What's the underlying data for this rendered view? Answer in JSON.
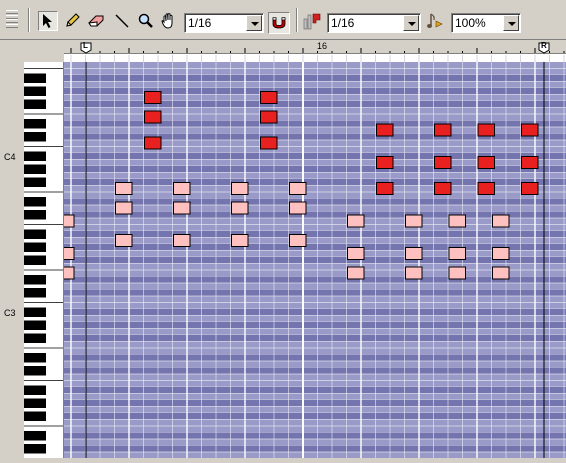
{
  "toolbar": {
    "snap_value": "1/16",
    "quantize_value": "1/16",
    "zoom_value": "100%"
  },
  "ruler": {
    "bar_label": "16",
    "left_marker": "L",
    "right_marker": "R"
  },
  "piano": {
    "c4_label": "C4",
    "c3_label": "C3"
  },
  "colors": {
    "grid_row_light": "#9a9ac8",
    "grid_row_dark": "#7474ae",
    "grid_line": "#ececf6",
    "accent_note": "#e82020",
    "soft_note": "#ffc0c0"
  },
  "notes": [
    {
      "pitch": 79,
      "start": 5,
      "length": 1,
      "accent": true
    },
    {
      "pitch": 79,
      "start": 13,
      "length": 1,
      "accent": true
    },
    {
      "pitch": 76,
      "start": 5,
      "length": 1,
      "accent": true
    },
    {
      "pitch": 76,
      "start": 13,
      "length": 1,
      "accent": true
    },
    {
      "pitch": 72,
      "start": 5,
      "length": 1,
      "accent": true
    },
    {
      "pitch": 72,
      "start": 13,
      "length": 1,
      "accent": true
    },
    {
      "pitch": 74,
      "start": 21,
      "length": 1,
      "accent": true
    },
    {
      "pitch": 74,
      "start": 25,
      "length": 1,
      "accent": true
    },
    {
      "pitch": 74,
      "start": 28,
      "length": 1,
      "accent": true
    },
    {
      "pitch": 74,
      "start": 31,
      "length": 1,
      "accent": true
    },
    {
      "pitch": 69,
      "start": 21,
      "length": 1,
      "accent": true
    },
    {
      "pitch": 69,
      "start": 25,
      "length": 1,
      "accent": true
    },
    {
      "pitch": 69,
      "start": 28,
      "length": 1,
      "accent": true
    },
    {
      "pitch": 69,
      "start": 31,
      "length": 1,
      "accent": true
    },
    {
      "pitch": 65,
      "start": 21,
      "length": 1,
      "accent": true
    },
    {
      "pitch": 65,
      "start": 25,
      "length": 1,
      "accent": true
    },
    {
      "pitch": 65,
      "start": 28,
      "length": 1,
      "accent": true
    },
    {
      "pitch": 65,
      "start": 31,
      "length": 1,
      "accent": true
    },
    {
      "pitch": 65,
      "start": 3,
      "length": 1,
      "accent": false
    },
    {
      "pitch": 65,
      "start": 7,
      "length": 1,
      "accent": false
    },
    {
      "pitch": 65,
      "start": 11,
      "length": 1,
      "accent": false
    },
    {
      "pitch": 65,
      "start": 15,
      "length": 1,
      "accent": false
    },
    {
      "pitch": 62,
      "start": 3,
      "length": 1,
      "accent": false
    },
    {
      "pitch": 62,
      "start": 7,
      "length": 1,
      "accent": false
    },
    {
      "pitch": 62,
      "start": 11,
      "length": 1,
      "accent": false
    },
    {
      "pitch": 62,
      "start": 15,
      "length": 1,
      "accent": false
    },
    {
      "pitch": 57,
      "start": 3,
      "length": 1,
      "accent": false
    },
    {
      "pitch": 57,
      "start": 7,
      "length": 1,
      "accent": false
    },
    {
      "pitch": 57,
      "start": 11,
      "length": 1,
      "accent": false
    },
    {
      "pitch": 57,
      "start": 15,
      "length": 1,
      "accent": false
    },
    {
      "pitch": 60,
      "start": -1,
      "length": 1,
      "accent": false
    },
    {
      "pitch": 60,
      "start": 19,
      "length": 1,
      "accent": false
    },
    {
      "pitch": 60,
      "start": 23,
      "length": 1,
      "accent": false
    },
    {
      "pitch": 60,
      "start": 26,
      "length": 1,
      "accent": false
    },
    {
      "pitch": 60,
      "start": 29,
      "length": 1,
      "accent": false
    },
    {
      "pitch": 55,
      "start": -1,
      "length": 1,
      "accent": false
    },
    {
      "pitch": 55,
      "start": 19,
      "length": 1,
      "accent": false
    },
    {
      "pitch": 55,
      "start": 23,
      "length": 1,
      "accent": false
    },
    {
      "pitch": 55,
      "start": 26,
      "length": 1,
      "accent": false
    },
    {
      "pitch": 55,
      "start": 29,
      "length": 1,
      "accent": false
    },
    {
      "pitch": 52,
      "start": -1,
      "length": 1,
      "accent": false
    },
    {
      "pitch": 52,
      "start": 19,
      "length": 1,
      "accent": false
    },
    {
      "pitch": 52,
      "start": 23,
      "length": 1,
      "accent": false
    },
    {
      "pitch": 52,
      "start": 26,
      "length": 1,
      "accent": false
    },
    {
      "pitch": 52,
      "start": 29,
      "length": 1,
      "accent": false
    }
  ]
}
